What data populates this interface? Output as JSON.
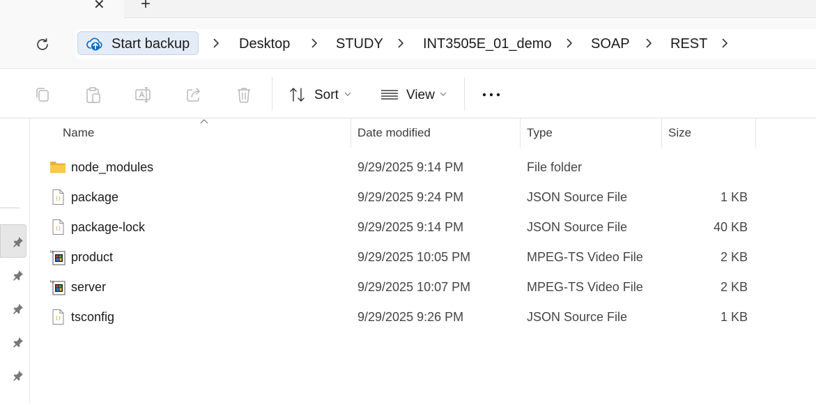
{
  "tabs": {
    "close_glyph": "✕",
    "new_glyph": "+"
  },
  "address": {
    "backup_label": "Start backup",
    "crumbs": [
      "Desktop",
      "STUDY",
      "INT3505E_01_demo",
      "SOAP",
      "REST"
    ]
  },
  "toolbar": {
    "sort_label": "Sort",
    "view_label": "View"
  },
  "columns": {
    "name": "Name",
    "date": "Date modified",
    "type": "Type",
    "size": "Size"
  },
  "files": [
    {
      "name": "node_modules",
      "date": "9/29/2025 9:14 PM",
      "type": "File folder",
      "size": "",
      "icon": "folder-icon"
    },
    {
      "name": "package",
      "date": "9/29/2025 9:24 PM",
      "type": "JSON Source File",
      "size": "1 KB",
      "icon": "json-file-icon"
    },
    {
      "name": "package-lock",
      "date": "9/29/2025 9:14 PM",
      "type": "JSON Source File",
      "size": "40 KB",
      "icon": "json-file-icon"
    },
    {
      "name": "product",
      "date": "9/29/2025 10:05 PM",
      "type": "MPEG-TS Video File",
      "size": "2 KB",
      "icon": "video-file-icon"
    },
    {
      "name": "server",
      "date": "9/29/2025 10:07 PM",
      "type": "MPEG-TS Video File",
      "size": "2 KB",
      "icon": "video-file-icon"
    },
    {
      "name": "tsconfig",
      "date": "9/29/2025 9:26 PM",
      "type": "JSON Source File",
      "size": "1 KB",
      "icon": "json-file-icon"
    }
  ],
  "colors": {
    "accent": "#0067c0",
    "folder": "#f8c94a",
    "selection": "#e6e6e6"
  }
}
